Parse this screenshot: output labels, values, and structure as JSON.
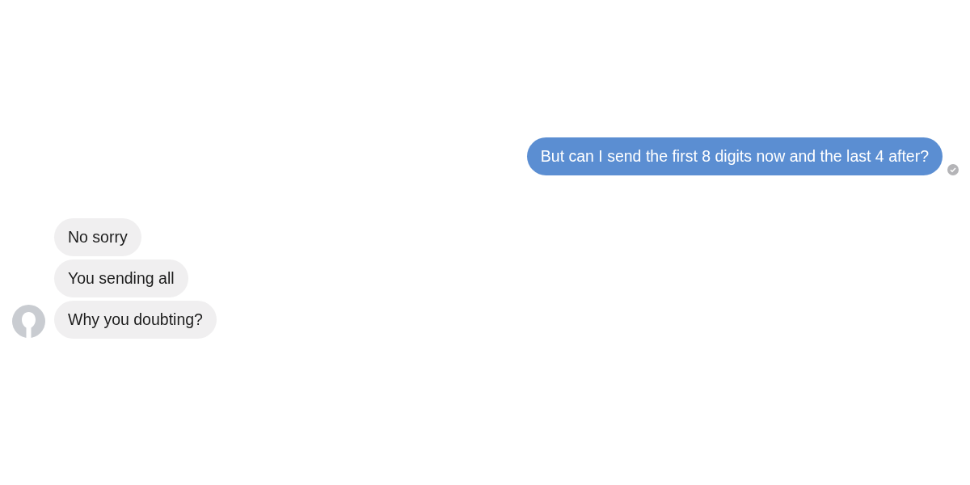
{
  "outgoing": [
    {
      "text": "But can I send the first 8 digits now and the last 4 after?",
      "delivered": true
    }
  ],
  "incoming": {
    "messages": [
      {
        "text": "No sorry"
      },
      {
        "text": "You sending all"
      },
      {
        "text": "Why you doubting?"
      }
    ]
  }
}
